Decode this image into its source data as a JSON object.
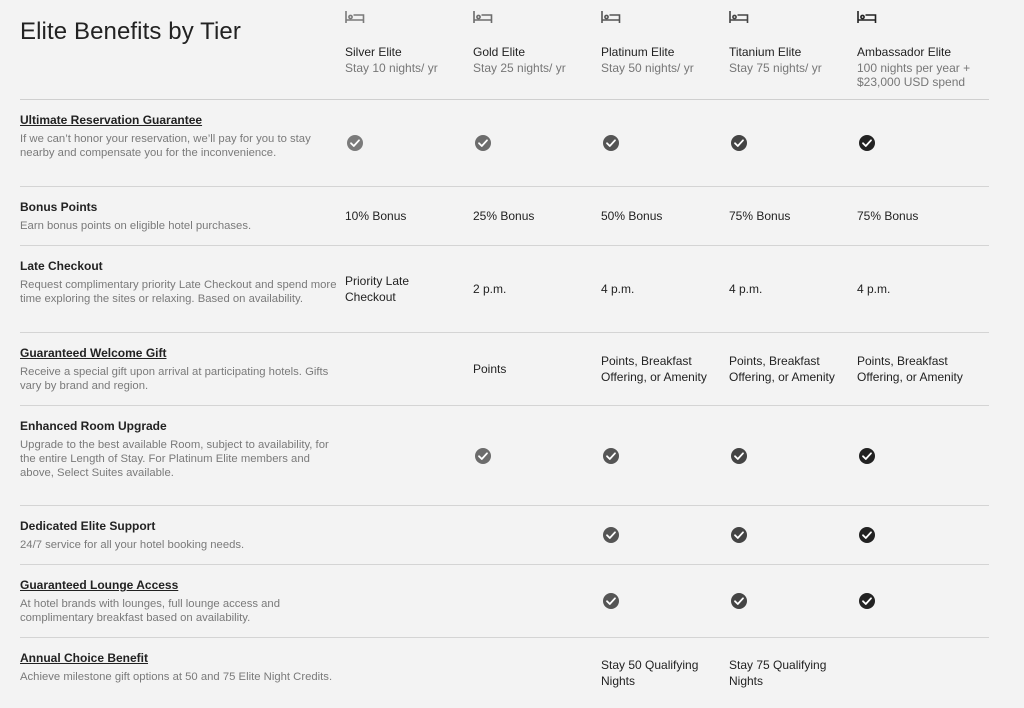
{
  "page": {
    "title": "Elite Benefits by Tier"
  },
  "tiers": [
    {
      "name": "Silver Elite",
      "requirement": "Stay 10 nights/ yr",
      "icon": "bed-icon",
      "color": "#7b7b7b"
    },
    {
      "name": "Gold Elite",
      "requirement": "Stay 25 nights/ yr",
      "icon": "bed-icon",
      "color": "#6c6c6c"
    },
    {
      "name": "Platinum Elite",
      "requirement": "Stay 50 nights/ yr",
      "icon": "bed-icon",
      "color": "#555555"
    },
    {
      "name": "Titanium Elite",
      "requirement": "Stay 75 nights/ yr",
      "icon": "bed-icon",
      "color": "#444444"
    },
    {
      "name": "Ambassador Elite",
      "requirement": "100 nights per year + $23,000 USD spend",
      "icon": "bed-icon",
      "color": "#222222"
    }
  ],
  "benefits": [
    {
      "name": "Ultimate Reservation Guarantee",
      "link": true,
      "description": "If we can’t honor your reservation, we’ll pay for you to stay nearby and compensate you for the inconvenience.",
      "values": [
        {
          "type": "check"
        },
        {
          "type": "check"
        },
        {
          "type": "check"
        },
        {
          "type": "check"
        },
        {
          "type": "check"
        }
      ]
    },
    {
      "name": "Bonus Points",
      "link": false,
      "description": "Earn bonus points on eligible hotel purchases.",
      "values": [
        {
          "type": "text",
          "text": "10% Bonus"
        },
        {
          "type": "text",
          "text": "25% Bonus"
        },
        {
          "type": "text",
          "text": "50% Bonus"
        },
        {
          "type": "text",
          "text": "75% Bonus"
        },
        {
          "type": "text",
          "text": "75% Bonus"
        }
      ]
    },
    {
      "name": "Late Checkout",
      "link": false,
      "description": "Request complimentary priority Late Checkout and spend more time exploring the sites or relaxing. Based on availability.",
      "values": [
        {
          "type": "text",
          "text": "Priority Late Checkout"
        },
        {
          "type": "text",
          "text": "2 p.m."
        },
        {
          "type": "text",
          "text": "4 p.m."
        },
        {
          "type": "text",
          "text": "4 p.m."
        },
        {
          "type": "text",
          "text": "4 p.m."
        }
      ]
    },
    {
      "name": "Guaranteed Welcome Gift",
      "link": true,
      "description": "Receive a special gift upon arrival at participating hotels. Gifts vary by brand and region.",
      "values": [
        {
          "type": "empty"
        },
        {
          "type": "text",
          "text": "Points"
        },
        {
          "type": "text",
          "text": "Points, Breakfast Offering, or Amenity"
        },
        {
          "type": "text",
          "text": "Points, Breakfast Offering, or Amenity"
        },
        {
          "type": "text",
          "text": "Points, Breakfast Offering, or Amenity"
        }
      ]
    },
    {
      "name": "Enhanced Room Upgrade",
      "link": false,
      "description": "Upgrade to the best available Room, subject to availability, for the entire Length of Stay. For Platinum Elite members and above, Select Suites available.",
      "values": [
        {
          "type": "empty"
        },
        {
          "type": "check"
        },
        {
          "type": "check"
        },
        {
          "type": "check"
        },
        {
          "type": "check"
        }
      ]
    },
    {
      "name": "Dedicated Elite Support",
      "link": false,
      "description": "24/7 service for all your hotel booking needs.",
      "values": [
        {
          "type": "empty"
        },
        {
          "type": "empty"
        },
        {
          "type": "check"
        },
        {
          "type": "check"
        },
        {
          "type": "check"
        }
      ]
    },
    {
      "name": "Guaranteed Lounge Access",
      "link": true,
      "description": "At hotel brands with lounges, full lounge access and complimentary breakfast based on availability.",
      "values": [
        {
          "type": "empty"
        },
        {
          "type": "empty"
        },
        {
          "type": "check"
        },
        {
          "type": "check"
        },
        {
          "type": "check"
        }
      ]
    },
    {
      "name": "Annual Choice Benefit",
      "link": true,
      "description": "Achieve milestone gift options at 50 and 75 Elite Night Credits.",
      "values": [
        {
          "type": "empty"
        },
        {
          "type": "empty"
        },
        {
          "type": "text",
          "text": "Stay 50 Qualifying Nights"
        },
        {
          "type": "text",
          "text": "Stay 75 Qualifying Nights"
        },
        {
          "type": "empty"
        }
      ]
    }
  ]
}
